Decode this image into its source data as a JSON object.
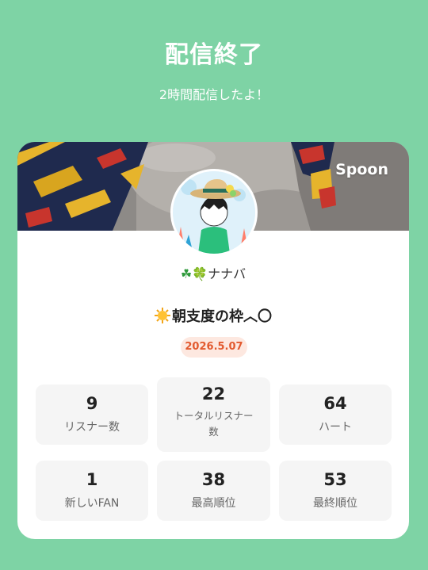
{
  "header": {
    "title": "配信終了",
    "subtitle": "2時間配信したよ！"
  },
  "card": {
    "brand": "Spoon",
    "username": "ナナバ",
    "username_prefix": "☘🍀",
    "broadcast_title": "朝支度の枠︿〇",
    "date": "2026.5.07"
  },
  "stats": [
    {
      "value": "9",
      "label": "リスナー数"
    },
    {
      "value": "22",
      "label": "トータルリスナー数"
    },
    {
      "value": "64",
      "label": "ハート"
    },
    {
      "value": "1",
      "label": "新しいFAN"
    },
    {
      "value": "38",
      "label": "最高順位"
    },
    {
      "value": "53",
      "label": "最終順位"
    }
  ],
  "colors": {
    "background": "#7ed3a5",
    "card": "#ffffff",
    "badge_bg": "#fde8e0",
    "badge_text": "#e2592e",
    "stat_bg": "#f5f5f5"
  }
}
